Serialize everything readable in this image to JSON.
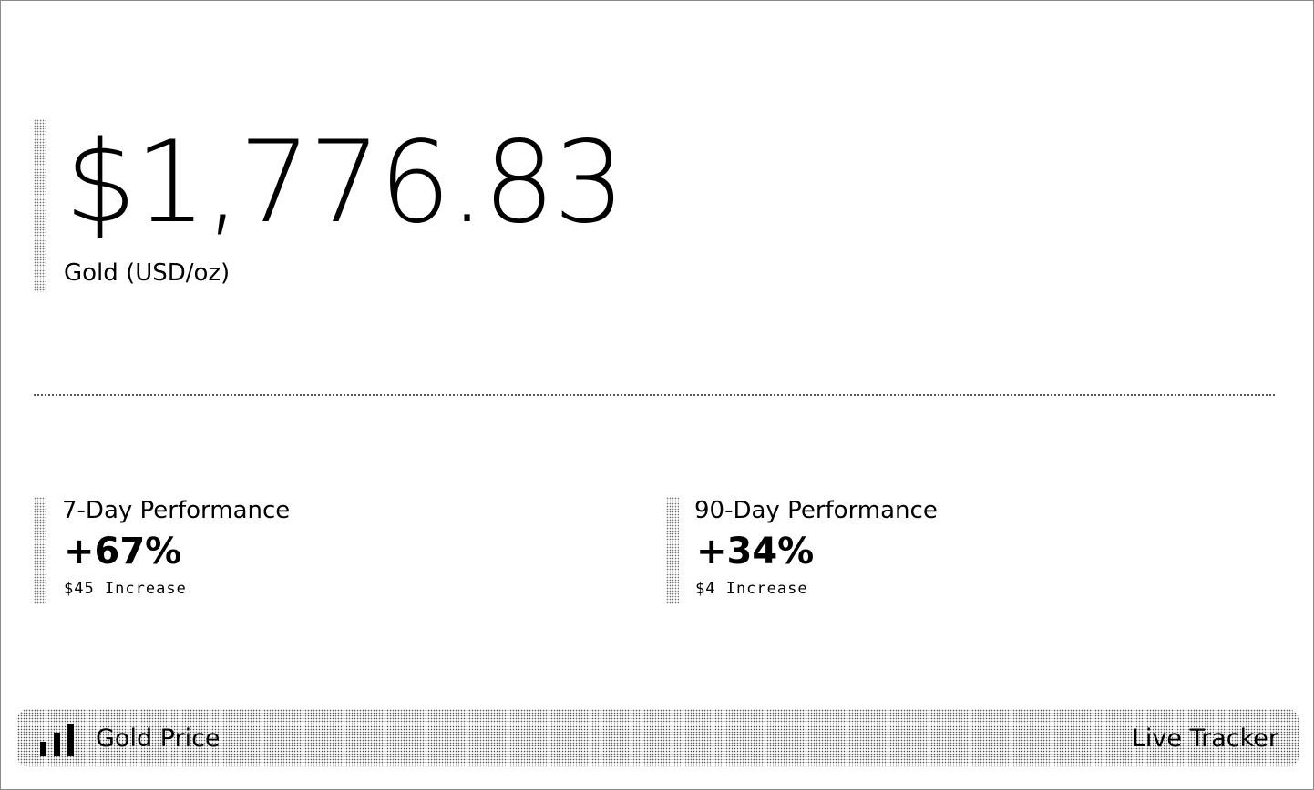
{
  "price": {
    "value": "$1,776.83",
    "label": "Gold (USD/oz)"
  },
  "performance": [
    {
      "title": "7-Day Performance",
      "value": "+67%",
      "detail": "$45 Increase"
    },
    {
      "title": "90-Day Performance",
      "value": "+34%",
      "detail": "$4 Increase"
    }
  ],
  "footer": {
    "icon": "bar-chart-icon",
    "left_label": "Gold Price",
    "right_label": "Live Tracker"
  },
  "colors": {
    "text": "#000000",
    "background": "#ffffff",
    "border": "#8a8a8a"
  }
}
